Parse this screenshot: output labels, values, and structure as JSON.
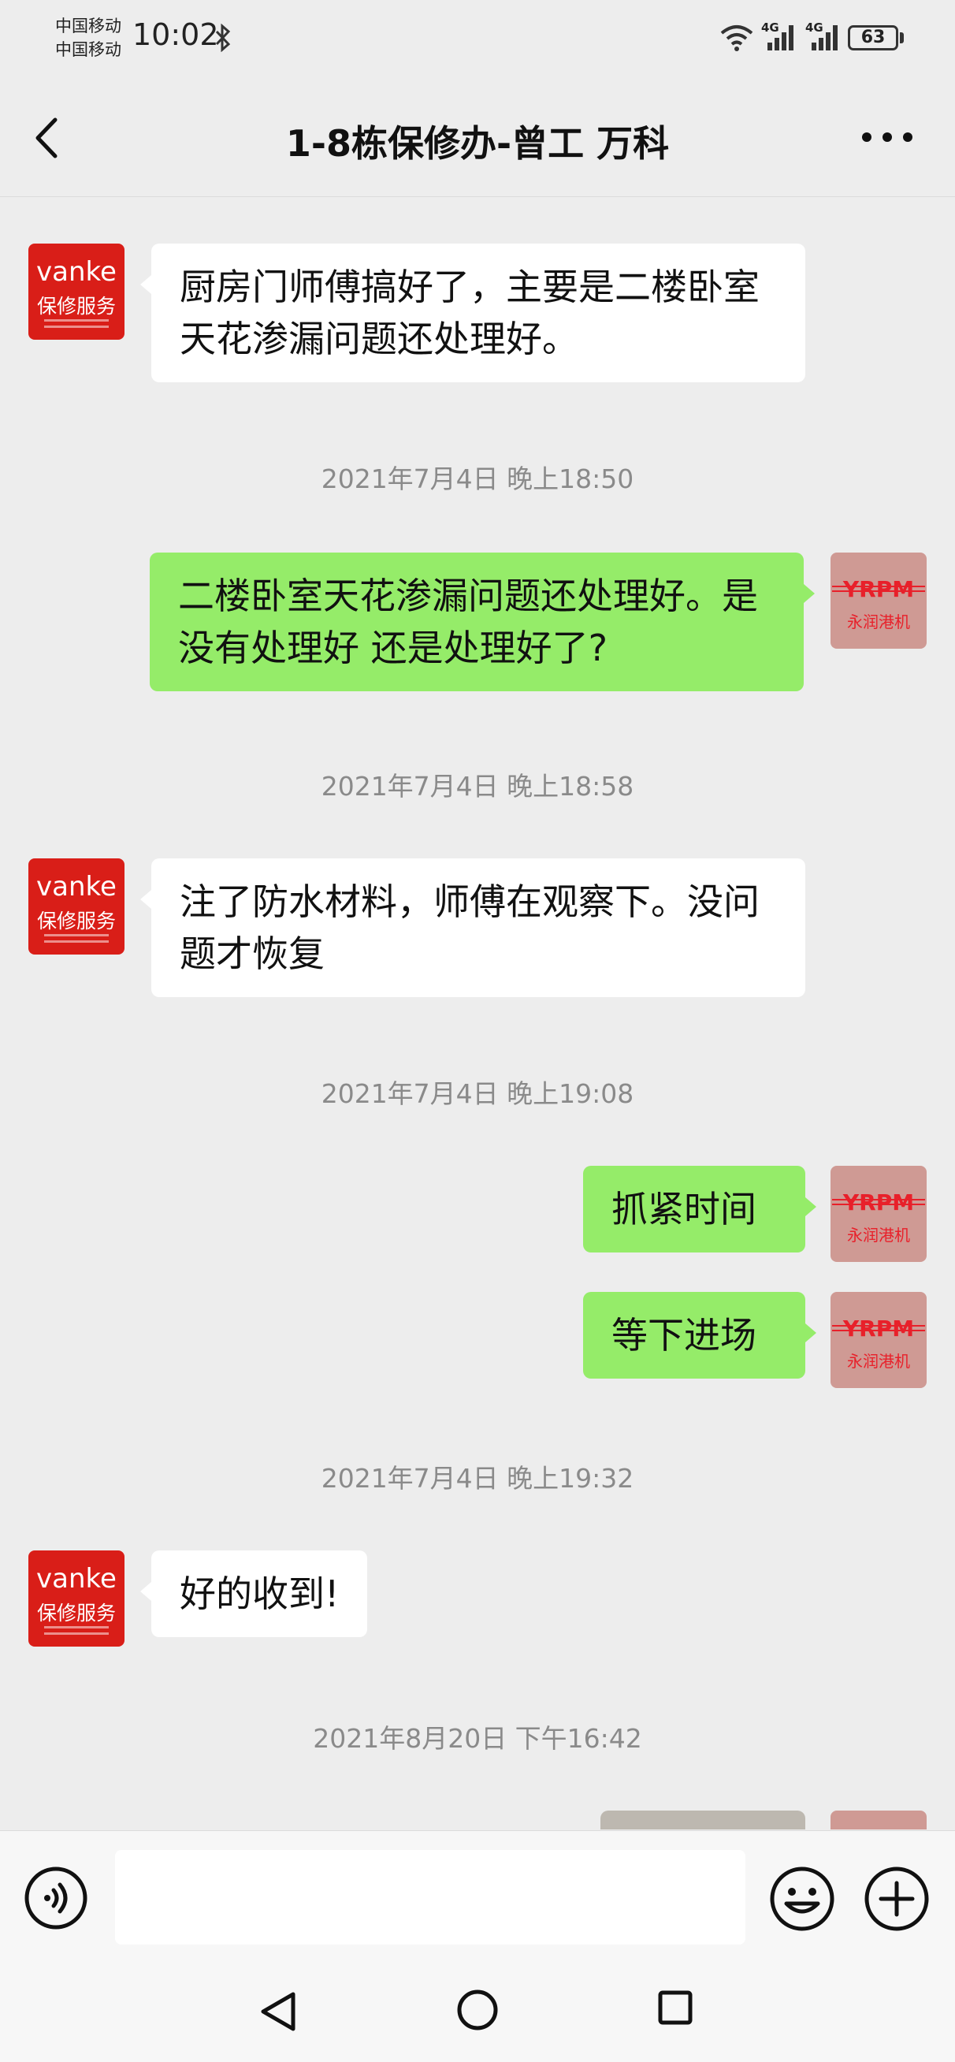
{
  "status_bar": {
    "carrier_1": "中国移动",
    "carrier_2": "中国移动",
    "time": "10:02",
    "network_1": "4G",
    "network_2": "4G",
    "battery": "63"
  },
  "header": {
    "title": "1-8栋保修办-曾工 万科"
  },
  "avatars": {
    "vanke_brand": "vanke",
    "vanke_sub": "保修服务",
    "yrpm_brand": "YRPM",
    "yrpm_sub": "永润港机"
  },
  "messages": [
    {
      "type": "text",
      "side": "left",
      "text": "厨房门师傅搞好了，主要是二楼卧室天花渗漏问题还处理好。"
    },
    {
      "type": "time",
      "text": "2021年7月4日 晚上18:50"
    },
    {
      "type": "text",
      "side": "right",
      "text": "二楼卧室天花渗漏问题还处理好。是没有处理好 还是处理好了?"
    },
    {
      "type": "time",
      "text": "2021年7月4日 晚上18:58"
    },
    {
      "type": "text",
      "side": "left",
      "text": "注了防水材料，师傅在观察下。没问题才恢复"
    },
    {
      "type": "time",
      "text": "2021年7月4日 晚上19:08"
    },
    {
      "type": "text",
      "side": "right",
      "text": "抓紧时间"
    },
    {
      "type": "text",
      "side": "right",
      "text": "等下进场"
    },
    {
      "type": "time",
      "text": "2021年7月4日 晚上19:32"
    },
    {
      "type": "text",
      "side": "left",
      "text": "好的收到!"
    },
    {
      "type": "time",
      "text": "2021年8月20日 下午16:42"
    },
    {
      "type": "image",
      "side": "right"
    }
  ],
  "input_bar": {
    "value": "",
    "placeholder": ""
  },
  "colors": {
    "background": "#ededed",
    "bubble_sent": "#95ec69",
    "bubble_received": "#ffffff",
    "vanke_red": "#d91e18",
    "yrpm_red": "#e8202a"
  },
  "icons": {
    "back": "back-chevron-icon",
    "more": "more-dots-icon",
    "voice": "voice-input-icon",
    "emoji": "emoji-icon",
    "plus": "plus-icon",
    "nav_back": "nav-back-icon",
    "nav_home": "nav-home-icon",
    "nav_recent": "nav-recent-apps-icon"
  }
}
